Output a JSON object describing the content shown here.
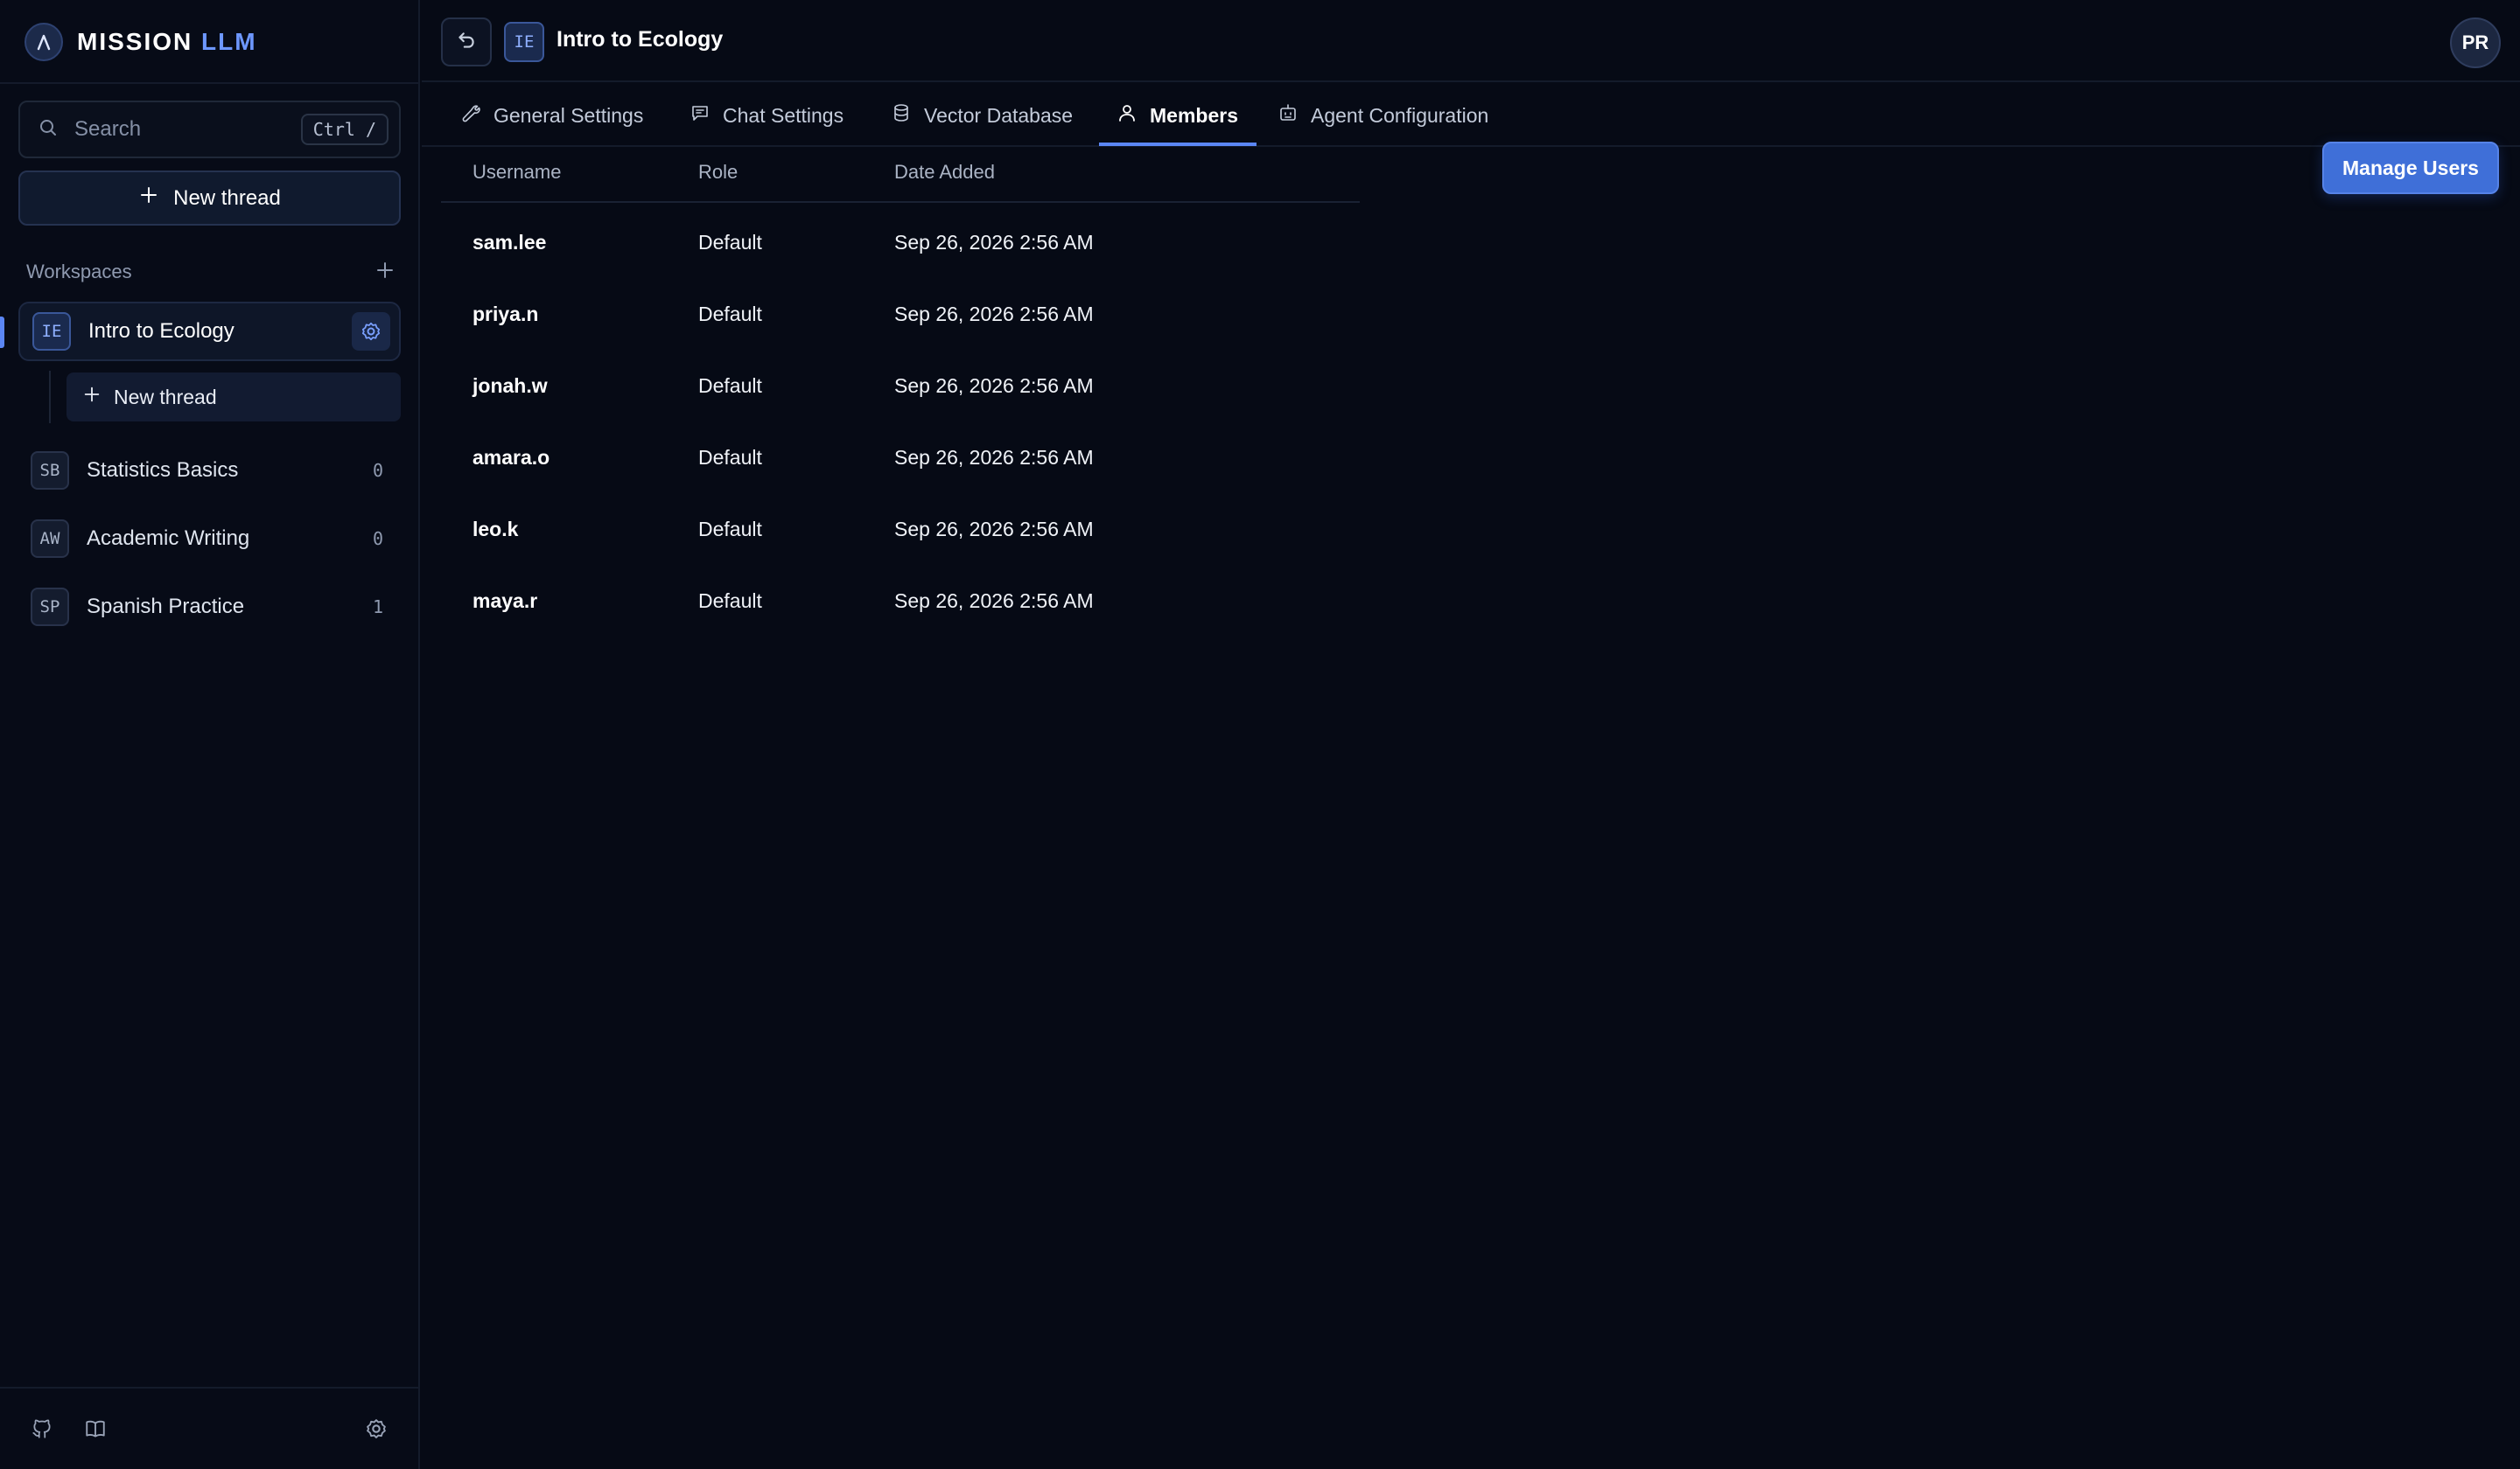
{
  "brand": {
    "name_part1": "MISSION",
    "name_part2": "LLM"
  },
  "sidebar": {
    "search_placeholder": "Search",
    "search_shortcut": "Ctrl /",
    "new_thread_label": "New thread",
    "workspaces_label": "Workspaces",
    "workspaces": [
      {
        "badge": "IE",
        "name": "Intro to Ecology",
        "active": true,
        "sub_new_thread_label": "New thread"
      },
      {
        "badge": "SB",
        "name": "Statistics Basics",
        "count": "0"
      },
      {
        "badge": "AW",
        "name": "Academic Writing",
        "count": "0"
      },
      {
        "badge": "SP",
        "name": "Spanish Practice",
        "count": "1"
      }
    ],
    "footer_icons": [
      "github-icon",
      "book-icon",
      "settings-icon"
    ]
  },
  "topbar": {
    "workspace_badge": "IE",
    "workspace_title": "Intro to Ecology",
    "user_initials": "PR"
  },
  "tabs": [
    {
      "label": "General Settings",
      "icon": "wrench-icon"
    },
    {
      "label": "Chat Settings",
      "icon": "chat-icon"
    },
    {
      "label": "Vector Database",
      "icon": "database-icon"
    },
    {
      "label": "Members",
      "icon": "user-icon",
      "active": true
    },
    {
      "label": "Agent Configuration",
      "icon": "robot-icon"
    }
  ],
  "members": {
    "manage_button_label": "Manage Users",
    "columns": [
      "Username",
      "Role",
      "Date Added"
    ],
    "rows": [
      {
        "username": "sam.lee",
        "role": "Default",
        "date_added": "Sep 26, 2026 2:56 AM"
      },
      {
        "username": "priya.n",
        "role": "Default",
        "date_added": "Sep 26, 2026 2:56 AM"
      },
      {
        "username": "jonah.w",
        "role": "Default",
        "date_added": "Sep 26, 2026 2:56 AM"
      },
      {
        "username": "amara.o",
        "role": "Default",
        "date_added": "Sep 26, 2026 2:56 AM"
      },
      {
        "username": "leo.k",
        "role": "Default",
        "date_added": "Sep 26, 2026 2:56 AM"
      },
      {
        "username": "maya.r",
        "role": "Default",
        "date_added": "Sep 26, 2026 2:56 AM"
      }
    ]
  },
  "colors": {
    "accent": "#5b86f5",
    "background": "#060a15",
    "button": "#3f6fd8"
  }
}
